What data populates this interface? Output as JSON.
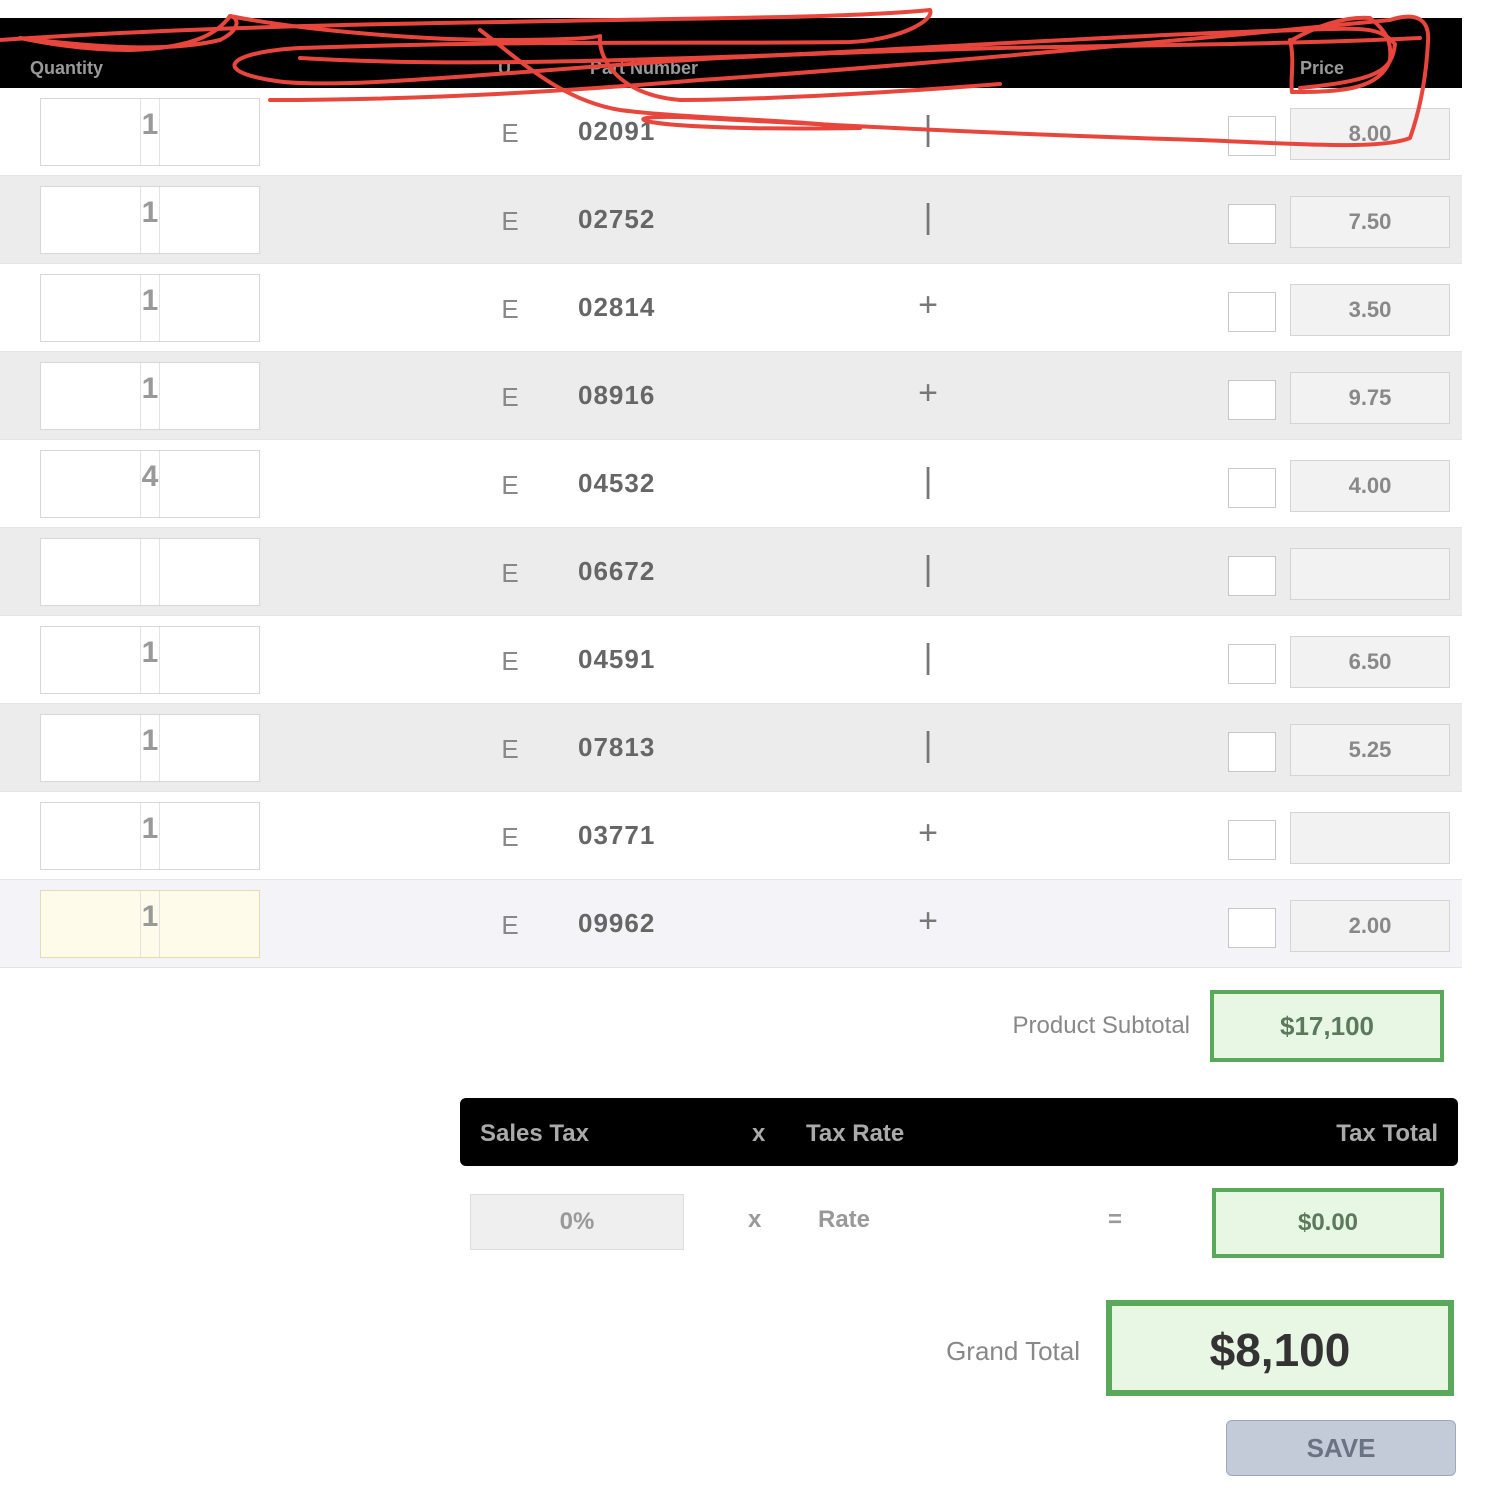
{
  "header": {
    "columns": [
      "Quantity",
      "U",
      "Part Number",
      "",
      "Price"
    ]
  },
  "rows": [
    {
      "qty": "1",
      "uom": "E",
      "code": "02091",
      "flag": "|",
      "price": "8.00"
    },
    {
      "qty": "1",
      "uom": "E",
      "code": "02752",
      "flag": "|",
      "price": "7.50"
    },
    {
      "qty": "1",
      "uom": "E",
      "code": "02814",
      "flag": "+",
      "price": "3.50"
    },
    {
      "qty": "1",
      "uom": "E",
      "code": "08916",
      "flag": "+",
      "price": "9.75"
    },
    {
      "qty": "4",
      "uom": "E",
      "code": "04532",
      "flag": "|",
      "price": "4.00"
    },
    {
      "qty": "",
      "uom": "E",
      "code": "06672",
      "flag": "|",
      "price": ""
    },
    {
      "qty": "1",
      "uom": "E",
      "code": "04591",
      "flag": "|",
      "price": "6.50"
    },
    {
      "qty": "1",
      "uom": "E",
      "code": "07813",
      "flag": "|",
      "price": "5.25"
    },
    {
      "qty": "1",
      "uom": "E",
      "code": "03771",
      "flag": "+",
      "price": ""
    },
    {
      "qty": "1",
      "uom": "E",
      "code": "09962",
      "flag": "+",
      "price": "2.00"
    }
  ],
  "subtotal": {
    "label": "Product Subtotal",
    "value": "$17,100"
  },
  "tax": {
    "bar_left": "Sales Tax",
    "bar_mid_sym": "x",
    "bar_mid": "Tax Rate",
    "bar_right": "Tax Total",
    "rate": "0%",
    "times": "x",
    "rate_label": "Rate",
    "equals": "=",
    "value": "$0.00"
  },
  "grand": {
    "label": "Grand Total",
    "value": "$8,100"
  },
  "save_label": "SAVE"
}
